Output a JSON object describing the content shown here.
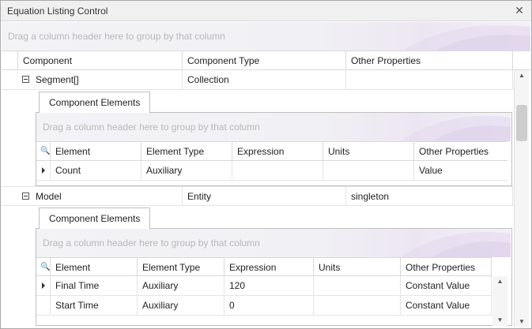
{
  "window": {
    "title": "Equation Listing Control"
  },
  "group_panel_hint": "Drag a column header here to group by that column",
  "outer_columns": [
    "Component",
    "Component Type",
    "Other Properties"
  ],
  "outer_rows": [
    {
      "component": "Segment[]",
      "type": "Collection",
      "other": ""
    },
    {
      "component": "Model",
      "type": "Entity",
      "other": "singleton"
    }
  ],
  "detail_tab_label": "Component Elements",
  "detail1": {
    "columns": [
      "Element",
      "Element Type",
      "Expression",
      "Units",
      "Other Properties"
    ],
    "rows": [
      {
        "element": "Count",
        "type": "Auxiliary",
        "expression": "",
        "units": "",
        "other": "Value"
      }
    ]
  },
  "detail2": {
    "columns": [
      "Element",
      "Element Type",
      "Expression",
      "Units",
      "Other Properties"
    ],
    "rows": [
      {
        "element": "Final Time",
        "type": "Auxiliary",
        "expression": "120",
        "units": "",
        "other": "Constant Value"
      },
      {
        "element": "Start Time",
        "type": "Auxiliary",
        "expression": "0",
        "units": "",
        "other": "Constant Value"
      }
    ]
  },
  "icons": {
    "close": "close-icon",
    "search": "search-icon",
    "expand": "collapse-icon",
    "row_indicator": "row-indicator-icon"
  }
}
